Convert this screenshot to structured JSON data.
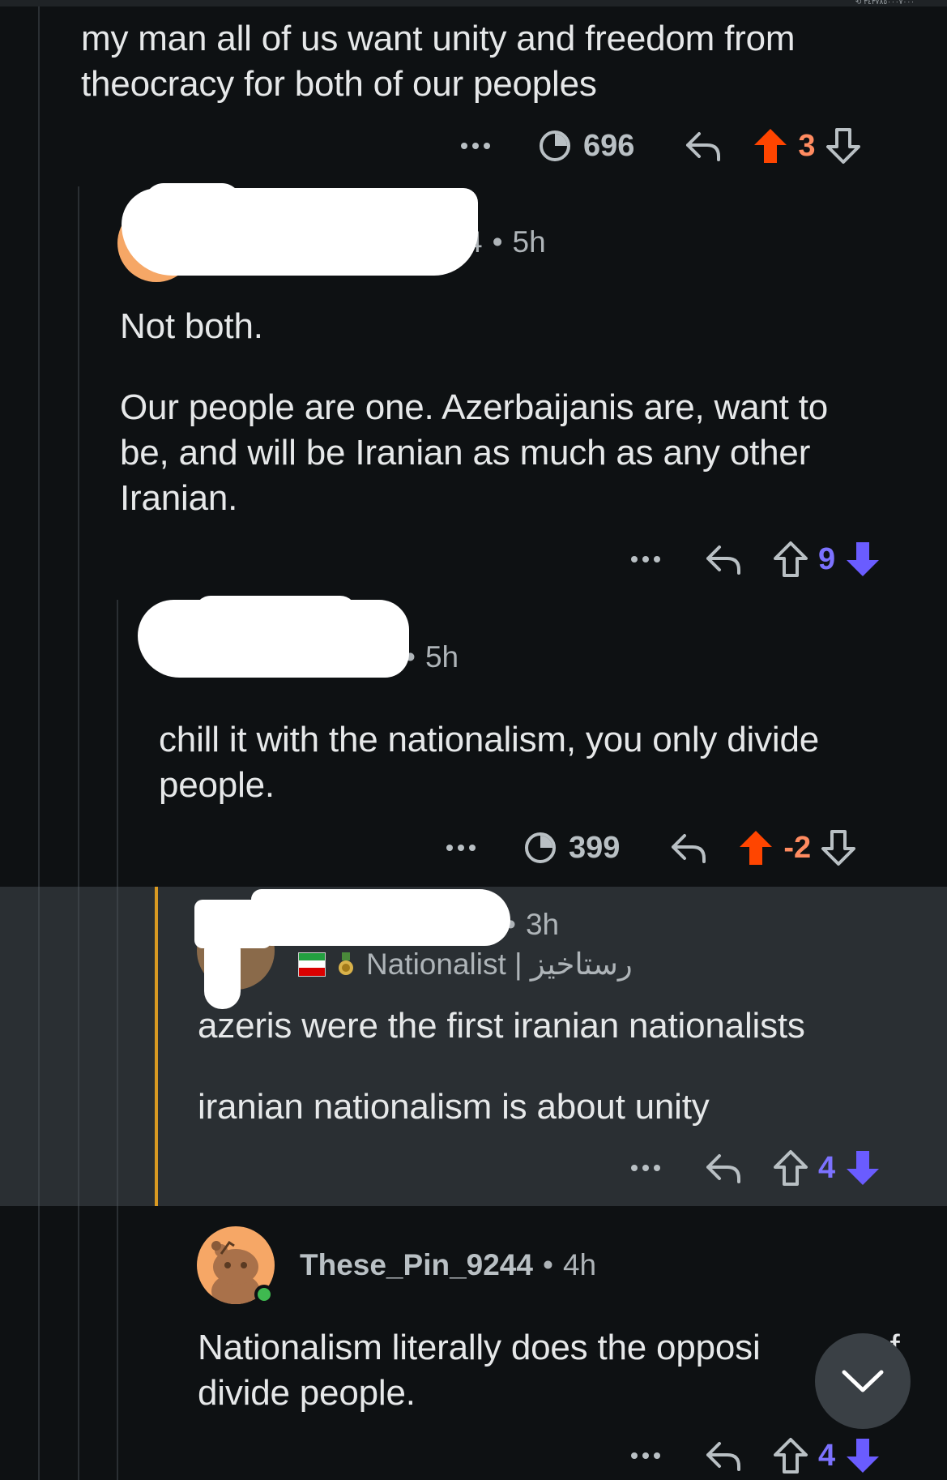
{
  "status_bar": {
    "mini_text": "⟲ ٣٤٣٧٨٥٠٠٠٧٠٠٠"
  },
  "comments": [
    {
      "id": "c1",
      "body": [
        "my man all of us want unity and freedom from",
        "theocracy for both of our peoples"
      ],
      "views": "696",
      "score": "3",
      "vote_state": "upvoted"
    },
    {
      "id": "c2",
      "username_suffix": "4",
      "time": "5h",
      "body_p1": "Not both.",
      "body_p2": [
        "Our people are one. Azerbaijanis are, want to",
        "be, and will be Iranian as much as any other",
        "Iranian."
      ],
      "score": "9",
      "vote_state": "downvoted"
    },
    {
      "id": "c3",
      "time": "5h",
      "body": [
        "chill it with the nationalism, you only divide",
        "people."
      ],
      "views": "399",
      "score": "-2",
      "vote_state": "upvoted"
    },
    {
      "id": "c4",
      "time": "3h",
      "flair": "Nationalist | رستاخیز",
      "body_p1": "azeris were the first iranian nationalists",
      "body_p2": "iranian nationalism is about unity",
      "score": "4",
      "vote_state": "downvoted",
      "highlighted": true
    },
    {
      "id": "c5",
      "username": "These_Pin_9244",
      "time": "4h",
      "body": [
        "Nationalism literally does the opposi",
        "divide people."
      ],
      "body_tail": "f",
      "score": "4",
      "vote_state": "downvoted"
    }
  ],
  "icons": {
    "more": "more-options-icon",
    "views": "views-clock-icon",
    "reply": "reply-arrow-icon",
    "upvote": "upvote-arrow-icon",
    "downvote": "downvote-arrow-icon",
    "scroll_down": "chevron-down-icon"
  },
  "colors": {
    "background": "#0e1113",
    "highlight_bg": "#2a2f33",
    "highlight_bar": "#d99a22",
    "upvote": "#ff4500",
    "upvote_score": "#ff8b60",
    "downvote": "#6a5cff",
    "downvote_score": "#7c72ff",
    "text": "#e6e8e9",
    "meta": "#aeb4b8"
  }
}
